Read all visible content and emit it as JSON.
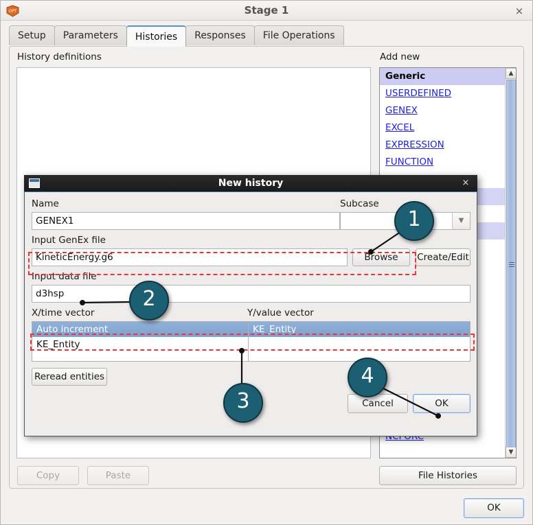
{
  "window": {
    "title": "Stage 1",
    "app_icon": "opt-logo-icon",
    "close_label": "×"
  },
  "tabs": [
    {
      "label": "Setup",
      "active": false
    },
    {
      "label": "Parameters",
      "active": false
    },
    {
      "label": "Histories",
      "active": true
    },
    {
      "label": "Responses",
      "active": false
    },
    {
      "label": "File Operations",
      "active": false
    }
  ],
  "panel": {
    "history_definitions_label": "History definitions",
    "add_new_label": "Add new",
    "add_new_items": [
      {
        "label": "Generic",
        "type": "header"
      },
      {
        "label": "USERDEFINED",
        "type": "link"
      },
      {
        "label": "GENEX",
        "type": "link"
      },
      {
        "label": "EXCEL",
        "type": "link"
      },
      {
        "label": "EXPRESSION",
        "type": "link"
      },
      {
        "label": "FUNCTION",
        "type": "link"
      },
      {
        "label": "NCFORC",
        "type": "link"
      }
    ],
    "copy_label": "Copy",
    "paste_label": "Paste",
    "file_histories_label": "File Histories"
  },
  "footer": {
    "ok_label": "OK"
  },
  "dialog": {
    "title": "New history",
    "close_label": "×",
    "name_label": "Name",
    "name_value": "GENEX1",
    "subcase_label": "Subcase",
    "subcase_value": "",
    "input_genex_label": "Input GenEx file",
    "input_genex_value": "KineticEnergy.g6",
    "browse_label": "Browse",
    "create_edit_label": "Create/Edit",
    "input_data_label": "Input data file",
    "input_data_value": "d3hsp",
    "x_vector_label": "X/time vector",
    "y_vector_label": "Y/value vector",
    "x_vector_items": [
      {
        "label": "Auto increment",
        "selected": true
      },
      {
        "label": "KE_Entity",
        "selected": false
      }
    ],
    "y_vector_items": [
      {
        "label": "KE_Entity",
        "selected": true
      }
    ],
    "reread_label": "Reread entities",
    "cancel_label": "Cancel",
    "ok_label": "OK"
  },
  "annotations": {
    "accent_color": "#1d5f72",
    "highlight_color": "#ef3333",
    "callouts": [
      {
        "number": "1"
      },
      {
        "number": "2"
      },
      {
        "number": "3"
      },
      {
        "number": "4"
      }
    ]
  }
}
